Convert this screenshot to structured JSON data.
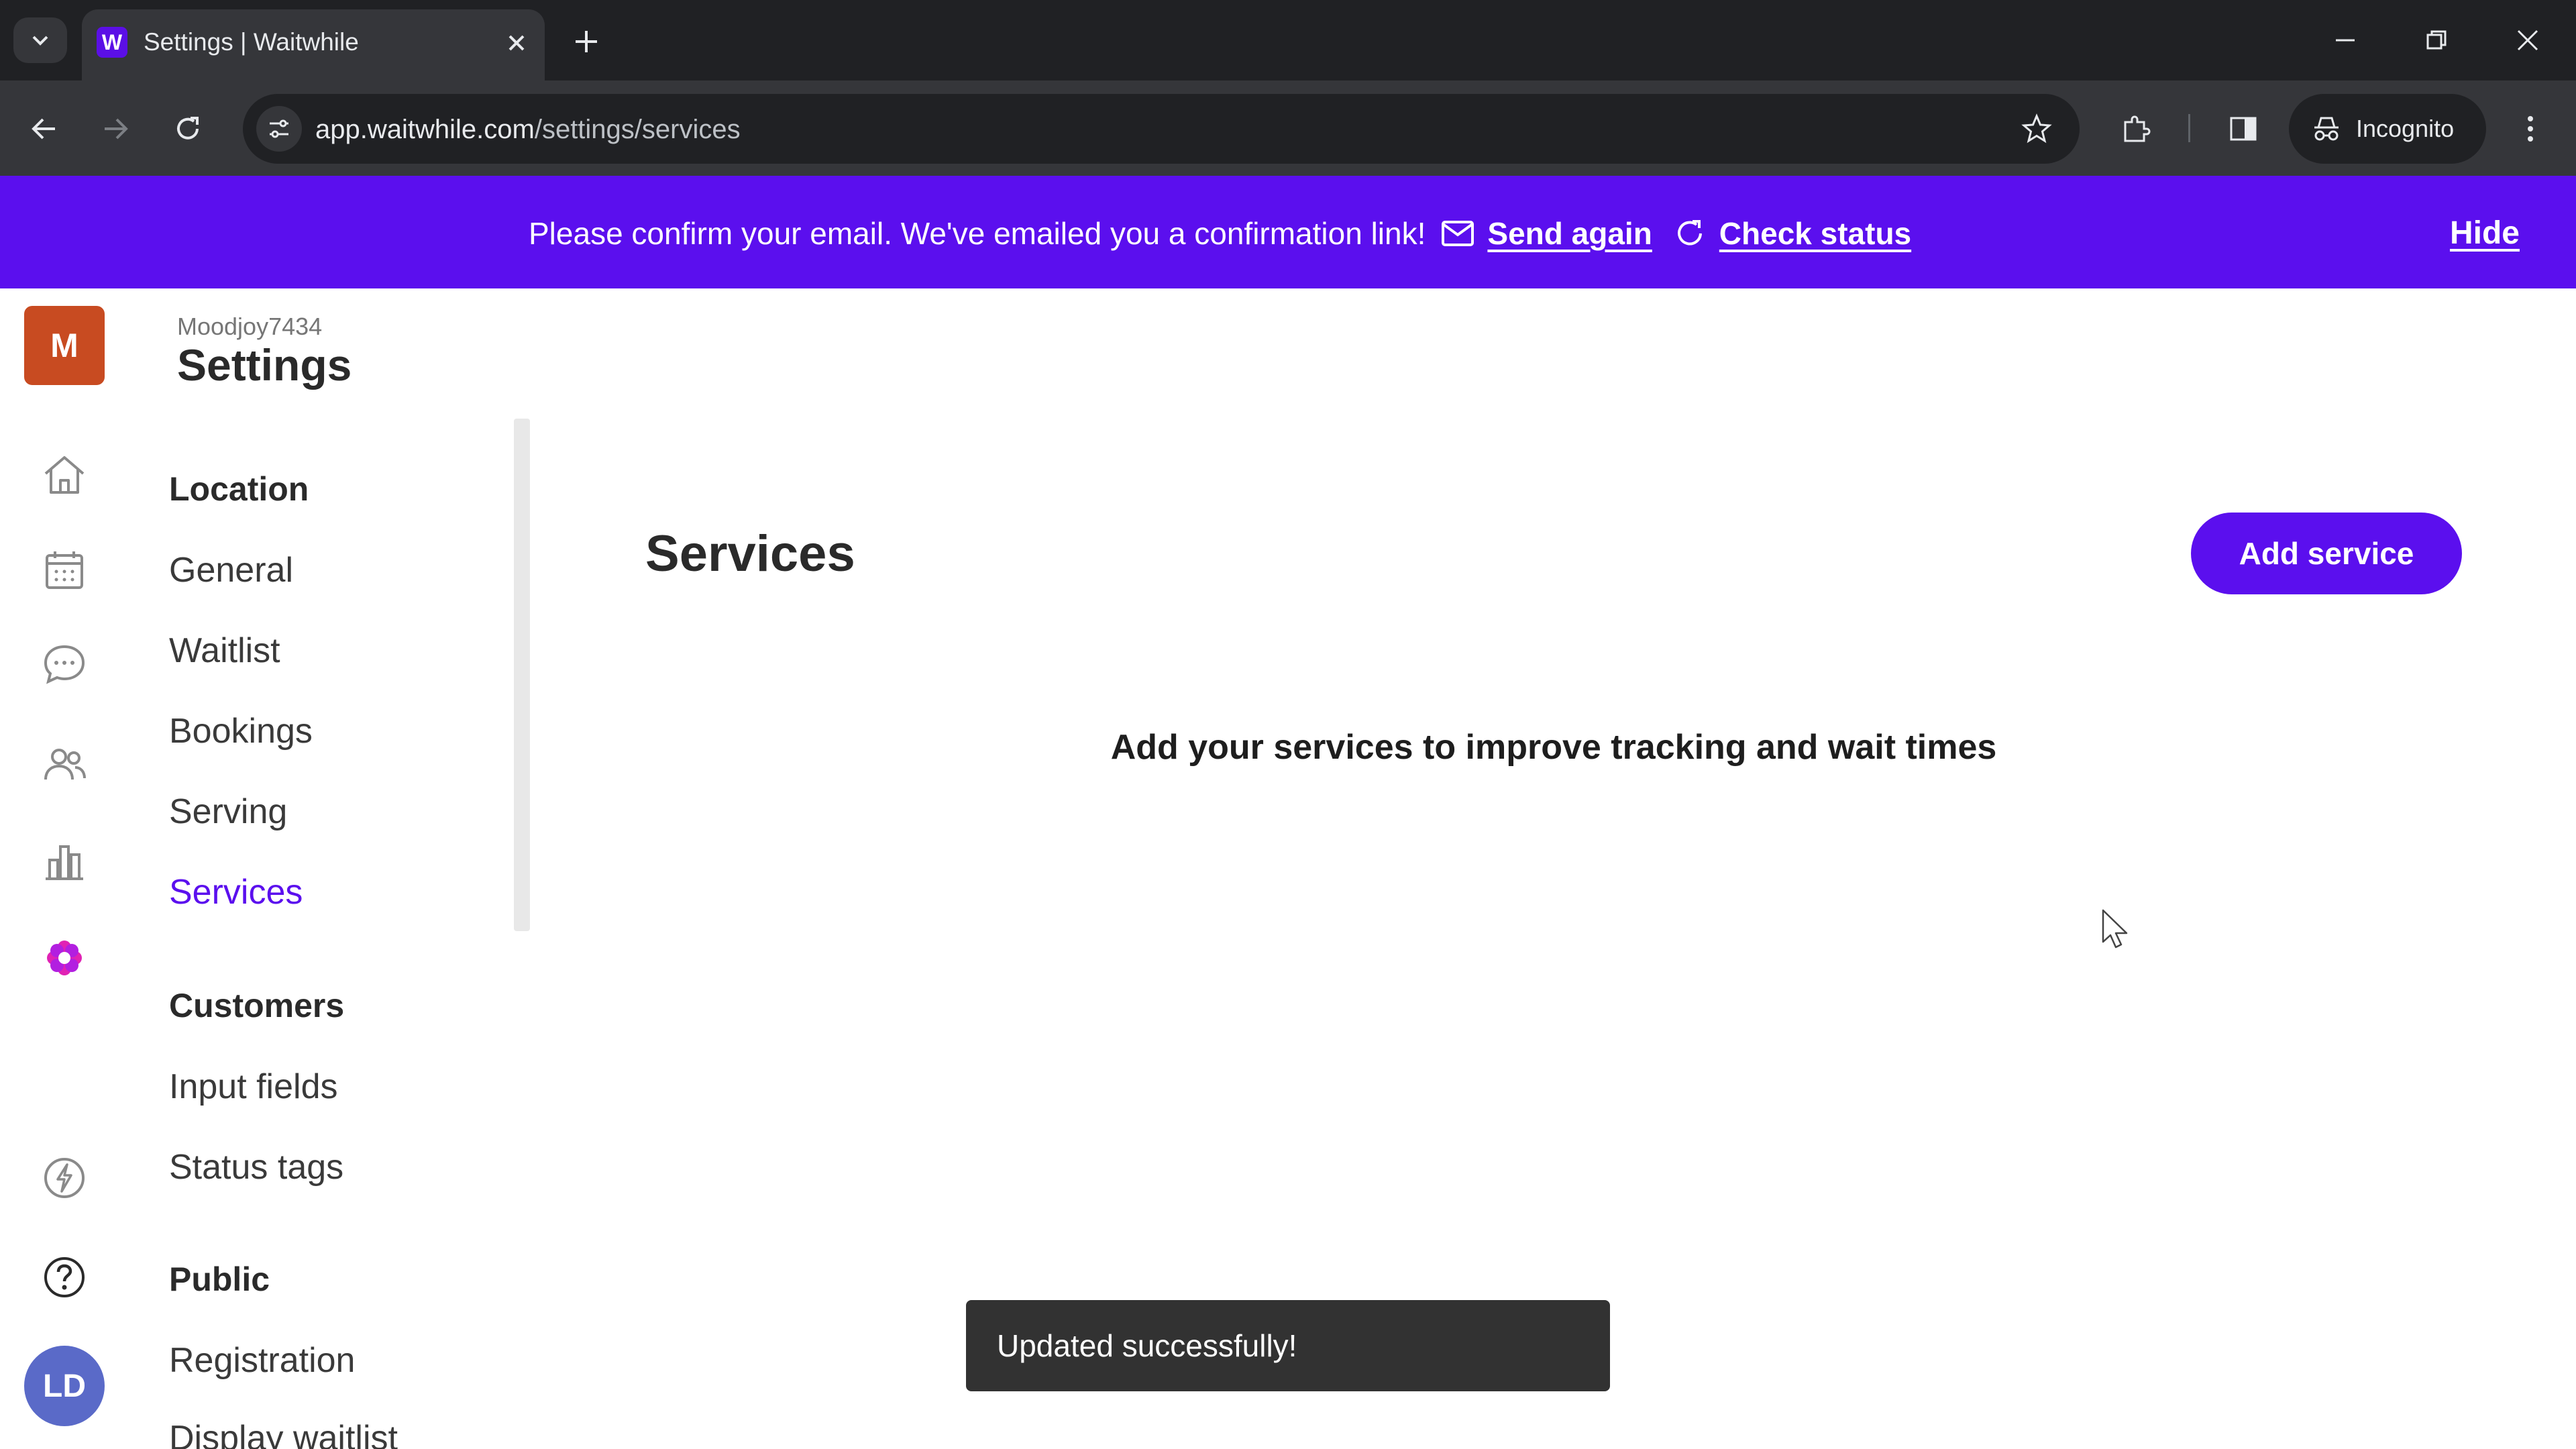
{
  "browser": {
    "tab_title": "Settings | Waitwhile",
    "favicon_letter": "W",
    "url_host": "app.waitwhile.com",
    "url_path": "/settings/services",
    "profile_label": "Incognito"
  },
  "banner": {
    "message": "Please confirm your email. We've emailed you a confirmation link!",
    "send_again": "Send again",
    "check_status": "Check status",
    "hide": "Hide",
    "color": "#5b0fee"
  },
  "header": {
    "org_initial": "M",
    "org_name": "Moodjoy7434",
    "title": "Settings"
  },
  "rail": {
    "icons": [
      "home-icon",
      "calendar-icon",
      "chat-icon",
      "users-icon",
      "analytics-icon",
      "settings-flower-icon",
      "lightning-icon",
      "help-icon"
    ],
    "avatar_initials": "LD"
  },
  "menu": {
    "location_heading": "Location",
    "location_items": [
      "General",
      "Waitlist",
      "Bookings",
      "Serving",
      "Services"
    ],
    "active_item": "Services",
    "customers_heading": "Customers",
    "customers_items": [
      "Input fields",
      "Status tags"
    ],
    "public_heading": "Public",
    "public_items": [
      "Registration",
      "Display waitlist"
    ]
  },
  "main": {
    "heading": "Services",
    "add_button": "Add service",
    "empty_message": "Add your services to improve tracking and wait times"
  },
  "toast": {
    "message": "Updated successfully!"
  }
}
